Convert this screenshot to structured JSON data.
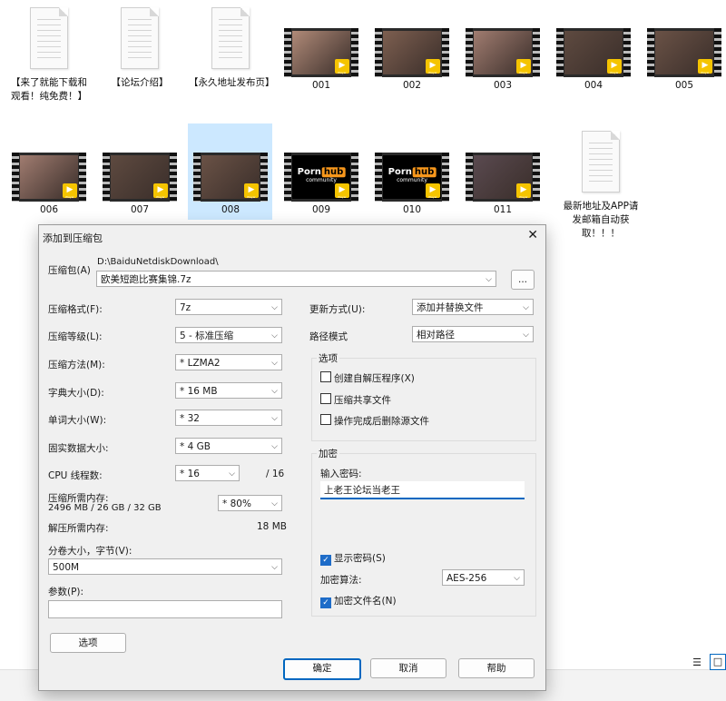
{
  "files_row1": [
    {
      "kind": "doc",
      "label": "【来了就能下载和观看！纯免费！】"
    },
    {
      "kind": "doc",
      "label": "【论坛介绍】"
    },
    {
      "kind": "doc",
      "label": "【永久地址发布页】"
    },
    {
      "kind": "video",
      "label": "001"
    },
    {
      "kind": "video",
      "label": "002"
    },
    {
      "kind": "video",
      "label": "003"
    },
    {
      "kind": "video",
      "label": "004"
    },
    {
      "kind": "video",
      "label": "005"
    }
  ],
  "files_row2": [
    {
      "kind": "video",
      "label": "006"
    },
    {
      "kind": "video",
      "label": "007"
    },
    {
      "kind": "video",
      "label": "008"
    },
    {
      "kind": "video",
      "label": "009",
      "brand": "Porn",
      "brand2": "hub",
      "sub": "community"
    },
    {
      "kind": "video",
      "label": "010",
      "brand": "Porn",
      "brand2": "hub",
      "sub": "community"
    },
    {
      "kind": "video",
      "label": "011"
    },
    {
      "kind": "doc",
      "label": "最新地址及APP请发邮箱自动获取！！！"
    }
  ],
  "badge_text": "Player",
  "dialog": {
    "title": "添加到压缩包",
    "close": "✕",
    "archive_label": "压缩包(A)",
    "archive_path": "D:\\BaiduNetdiskDownload\\",
    "archive_name": "欧美短跑比赛集锦.7z",
    "browse": "...",
    "format_label": "压缩格式(F):",
    "format": "7z",
    "level_label": "压缩等级(L):",
    "level": "5 - 标准压缩",
    "method_label": "压缩方法(M):",
    "method": "* LZMA2",
    "dict_label": "字典大小(D):",
    "dict": "* 16 MB",
    "word_label": "单词大小(W):",
    "word": "* 32",
    "solid_label": "固实数据大小:",
    "solid": "* 4 GB",
    "cpu_label": "CPU 线程数:",
    "cpu": "* 16",
    "cpu_total": "/ 16",
    "mem_label": "压缩所需内存:",
    "mem_value": "2496 MB / 26 GB / 32 GB",
    "mem_pct": "* 80%",
    "demem_label": "解压所需内存:",
    "demem_value": "18 MB",
    "volume_label": "分卷大小，字节(V):",
    "volume": "500M",
    "params_label": "参数(P):",
    "options_button": "选项",
    "update_label": "更新方式(U):",
    "update": "添加并替换文件",
    "path_label": "路径模式",
    "path": "相对路径",
    "options_group": "选项",
    "opt_sfx": "创建自解压程序(X)",
    "opt_shared": "压缩共享文件",
    "opt_delete": "操作完成后删除源文件",
    "enc_group": "加密",
    "pwd_label": "输入密码:",
    "pwd_value": "上老王论坛当老王",
    "show_pwd": "显示密码(S)",
    "enc_method_label": "加密算法:",
    "enc_method": "AES-256",
    "enc_names": "加密文件名(N)",
    "ok": "确定",
    "cancel": "取消",
    "help": "帮助"
  }
}
